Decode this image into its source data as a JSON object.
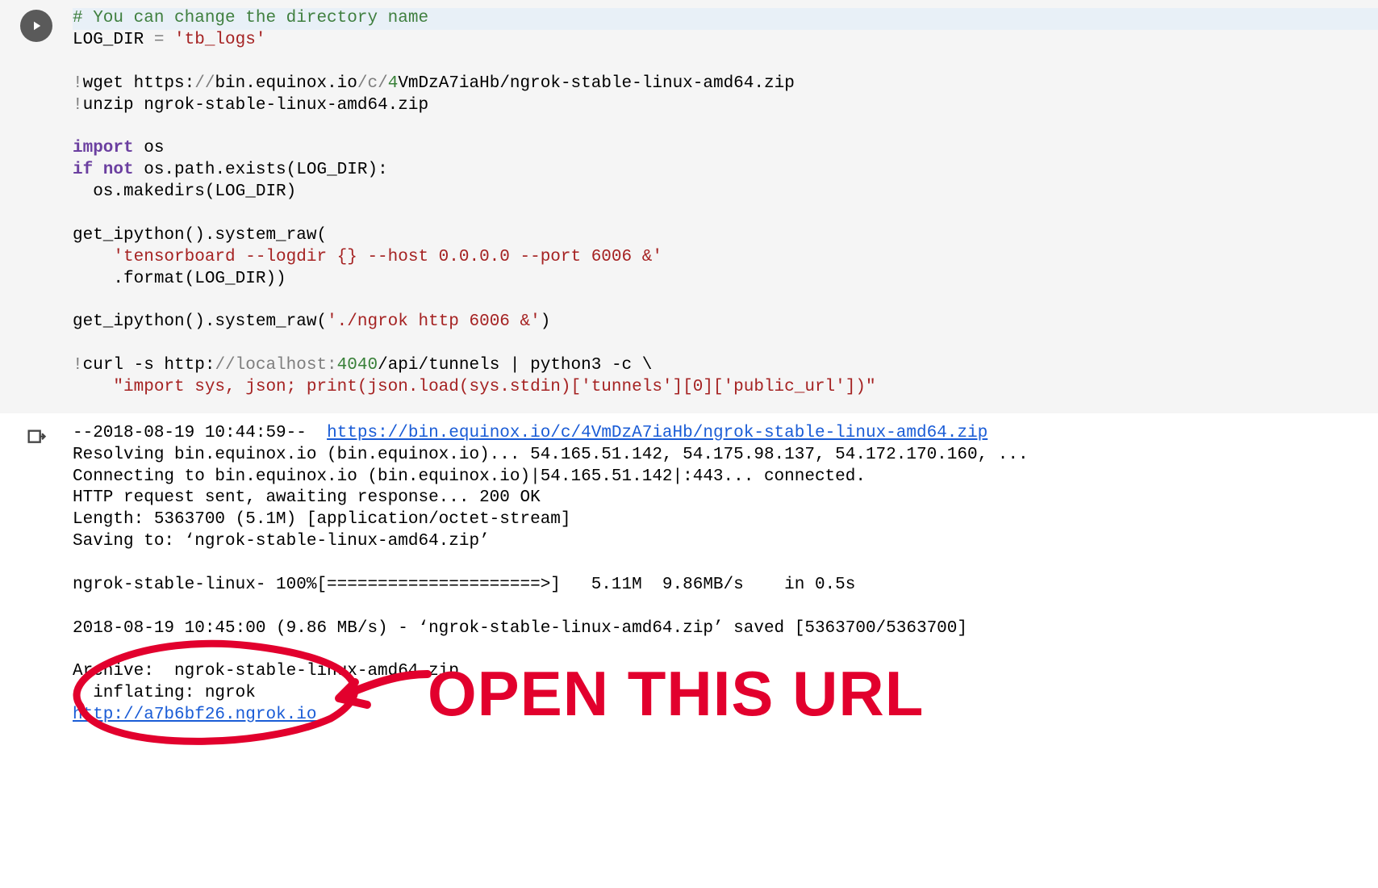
{
  "code": {
    "comment": "# You can change the directory name",
    "line1_var": "LOG_DIR",
    "line1_eq": " = ",
    "line1_str": "'tb_logs'",
    "wget_bang": "!",
    "wget_cmd": "wget https:",
    "wget_slashes": "//",
    "wget_host": "bin.equinox.io",
    "wget_path1": "/c/",
    "wget_num": "4",
    "wget_path2": "VmDzA7iaHb/ngrok-stable-linux-amd64.zip",
    "unzip_bang": "!",
    "unzip_cmd": "unzip ngrok-stable-linux-amd64.zip",
    "import_kw": "import",
    "import_mod": " os",
    "ifnot": "if not",
    "if_tail": " os.path.exists(LOG_DIR):",
    "makedirs": "  os.makedirs(LOG_DIR)",
    "gip1": "get_ipython().system_raw(",
    "tb_str": "    'tensorboard --logdir {} --host 0.0.0.0 --port 6006 &'",
    "fmt": "    .format(LOG_DIR))",
    "gip2_pre": "get_ipython().system_raw(",
    "gip2_str": "'./ngrok http 6006 &'",
    "gip2_post": ")",
    "curl_bang": "!",
    "curl_pre": "curl -s http:",
    "curl_host": "//localhost:",
    "curl_port": "4040",
    "curl_path": "/api/tunnels | python3 -c \\",
    "curl_str": "    \"import sys, json; print(json.load(sys.stdin)['tunnels'][0]['public_url'])\""
  },
  "output": {
    "l1_pre": "--2018-08-19 10:44:59--  ",
    "l1_link": "https://bin.equinox.io/c/4VmDzA7iaHb/ngrok-stable-linux-amd64.zip",
    "l2": "Resolving bin.equinox.io (bin.equinox.io)... 54.165.51.142, 54.175.98.137, 54.172.170.160, ...",
    "l3": "Connecting to bin.equinox.io (bin.equinox.io)|54.165.51.142|:443... connected.",
    "l4": "HTTP request sent, awaiting response... 200 OK",
    "l5": "Length: 5363700 (5.1M) [application/octet-stream]",
    "l6": "Saving to: ‘ngrok-stable-linux-amd64.zip’",
    "l7": "ngrok-stable-linux- 100%[=====================>]   5.11M  9.86MB/s    in 0.5s",
    "l8": "2018-08-19 10:45:00 (9.86 MB/s) - ‘ngrok-stable-linux-amd64.zip’ saved [5363700/5363700]",
    "l9": "Archive:  ngrok-stable-linux-amd64.zip",
    "l10": "  inflating: ngrok",
    "l11_link": "http://a7b6bf26.ngrok.io"
  },
  "annotation": {
    "label": "OPEN THIS URL"
  }
}
